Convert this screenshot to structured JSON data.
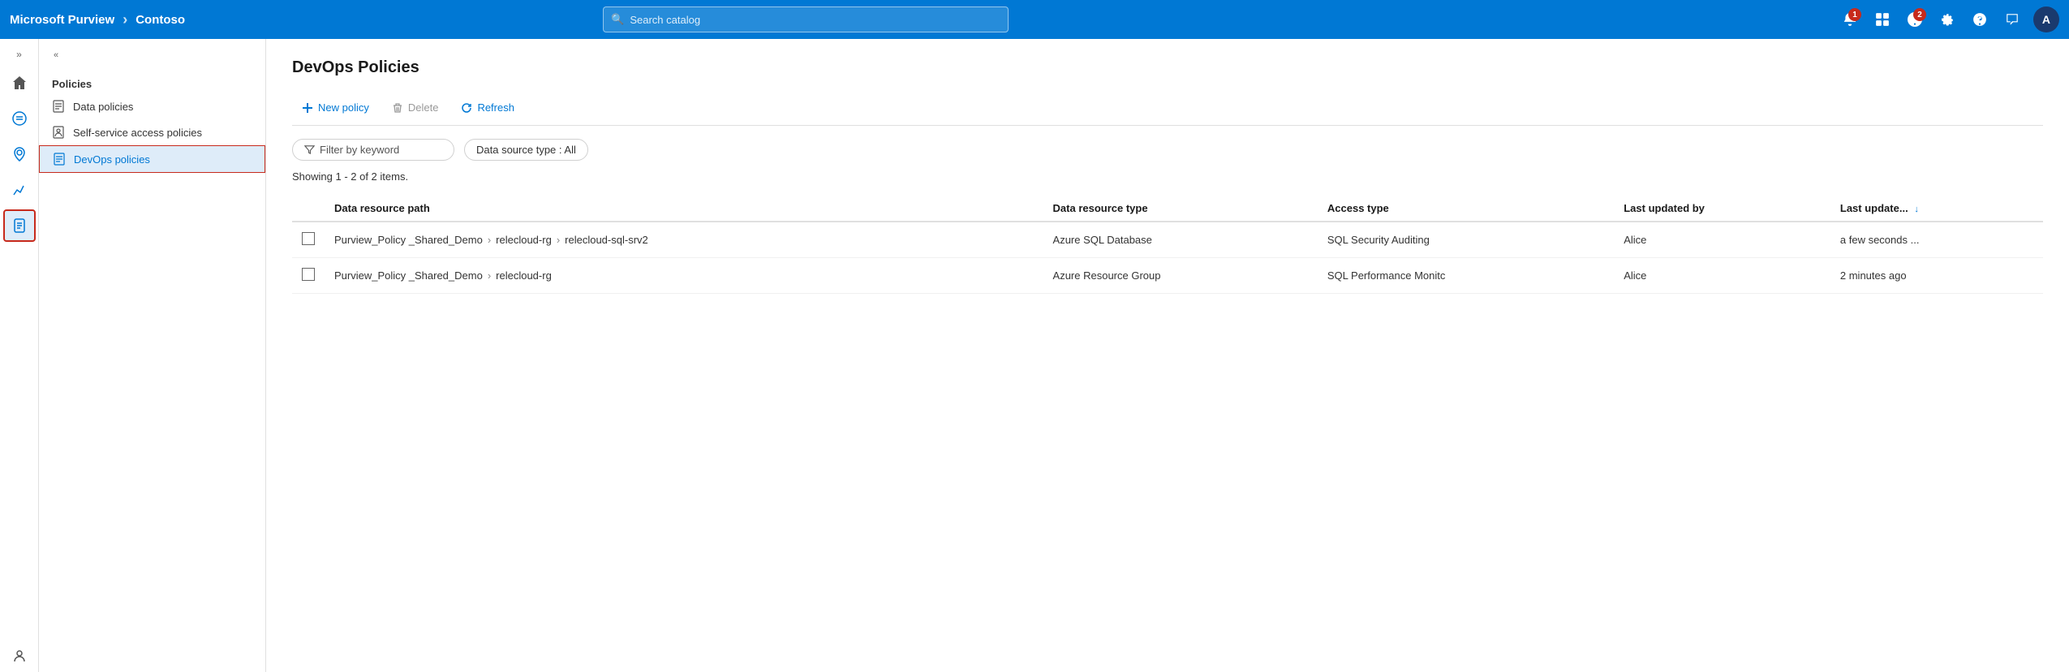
{
  "topbar": {
    "brand": "Microsoft Purview",
    "separator": "›",
    "tenant": "Contoso",
    "search_placeholder": "Search catalog",
    "avatar_label": "A",
    "notifications_badge": "1",
    "alerts_badge": "2"
  },
  "icon_sidebar": {
    "collapse_label": "»",
    "items": [
      {
        "id": "home",
        "icon": "home",
        "label": "Home"
      },
      {
        "id": "catalog",
        "icon": "catalog",
        "label": "Data catalog"
      },
      {
        "id": "map",
        "icon": "map",
        "label": "Data map"
      },
      {
        "id": "insights",
        "icon": "insights",
        "label": "Insights"
      },
      {
        "id": "policies",
        "icon": "policies",
        "label": "Policies",
        "active": true
      },
      {
        "id": "admin",
        "icon": "admin",
        "label": "Administration"
      }
    ]
  },
  "nav_panel": {
    "collapse_label": "«",
    "section_title": "Policies",
    "items": [
      {
        "id": "data-policies",
        "label": "Data policies",
        "active": false
      },
      {
        "id": "self-service",
        "label": "Self-service access policies",
        "active": false
      },
      {
        "id": "devops-policies",
        "label": "DevOps policies",
        "active": true
      }
    ]
  },
  "content": {
    "page_title": "DevOps Policies",
    "toolbar": {
      "new_policy_label": "New policy",
      "delete_label": "Delete",
      "refresh_label": "Refresh"
    },
    "filter": {
      "keyword_placeholder": "Filter by keyword",
      "datasource_filter": "Data source type : All"
    },
    "results_text": "Showing 1 - 2 of 2 items.",
    "table": {
      "columns": [
        {
          "id": "checkbox",
          "label": ""
        },
        {
          "id": "data_resource_path",
          "label": "Data resource path"
        },
        {
          "id": "data_resource_type",
          "label": "Data resource type"
        },
        {
          "id": "access_type",
          "label": "Access type"
        },
        {
          "id": "last_updated_by",
          "label": "Last updated by"
        },
        {
          "id": "last_updated",
          "label": "Last update...",
          "sorted": true
        }
      ],
      "rows": [
        {
          "path": "Purview_Policy _Shared_Demo > relecloud-rg > relecloud-sql-srv2",
          "path_parts": [
            "Purview_Policy _Shared_Demo",
            "relecloud-rg",
            "relecloud-sql-srv2"
          ],
          "data_resource_type": "Azure SQL Database",
          "access_type": "SQL Security Auditing",
          "last_updated_by": "Alice",
          "last_updated": "a few seconds ..."
        },
        {
          "path": "Purview_Policy _Shared_Demo > relecloud-rg",
          "path_parts": [
            "Purview_Policy _Shared_Demo",
            "relecloud-rg"
          ],
          "data_resource_type": "Azure Resource Group",
          "access_type": "SQL Performance Monitc",
          "last_updated_by": "Alice",
          "last_updated": "2 minutes ago"
        }
      ]
    }
  }
}
